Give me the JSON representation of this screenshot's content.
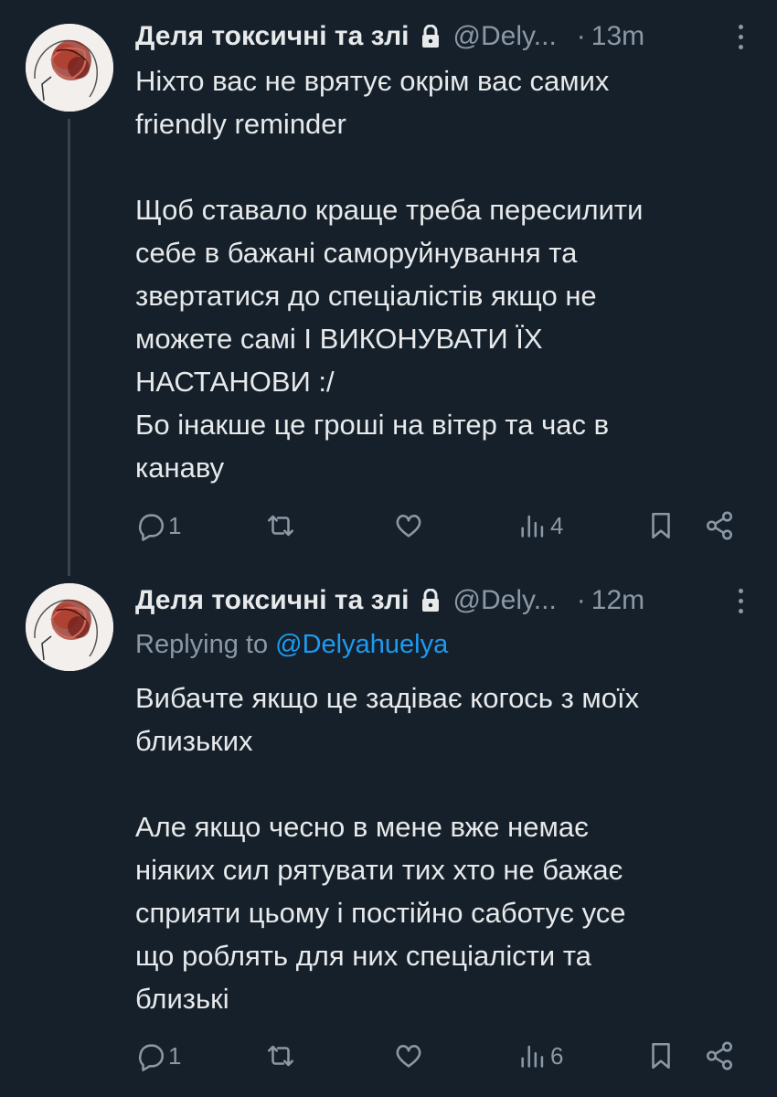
{
  "tweets": [
    {
      "author_name": "Деля токсичні та злі",
      "handle": "@Dely...",
      "separator": "·",
      "time": "13m",
      "lines": [
        "Ніхто вас не врятує окрім вас самих",
        "friendly reminder",
        "",
        "Щоб ставало краще треба пересилити",
        "себе в бажані саморуйнування та",
        "звертатися до спеціалістів якщо не",
        "можете самі І ВИКОНУВАТИ ЇХ",
        "НАСТАНОВИ :/",
        "Бо інакше це гроші на вітер та час в",
        "канаву"
      ],
      "reply_count": "1",
      "views_count": "4"
    },
    {
      "author_name": "Деля токсичні та злі",
      "handle": "@Dely...",
      "separator": "·",
      "time": "12m",
      "replying_prefix": "Replying to ",
      "replying_to": "@Delyahuelya",
      "lines": [
        "Вибачте якщо це задіває когось з моїх",
        "близьких",
        "",
        "Але якщо чесно в мене вже немає",
        "ніяких сил рятувати тих хто не бажає",
        "сприяти цьому і постійно саботує усе",
        "що роблять для них спеціалісти та",
        "близькі"
      ],
      "reply_count": "1",
      "views_count": "6"
    }
  ],
  "icons": {
    "reply": "reply-icon",
    "retweet": "retweet-icon",
    "like": "like-icon",
    "views": "views-icon",
    "bookmark": "bookmark-icon",
    "share": "share-icon",
    "lock": "lock-icon",
    "more": "more-icon"
  },
  "colors": {
    "background": "#15202b",
    "text": "#e7e9ea",
    "secondary": "#8b98a5",
    "link": "#1d9bf0"
  }
}
